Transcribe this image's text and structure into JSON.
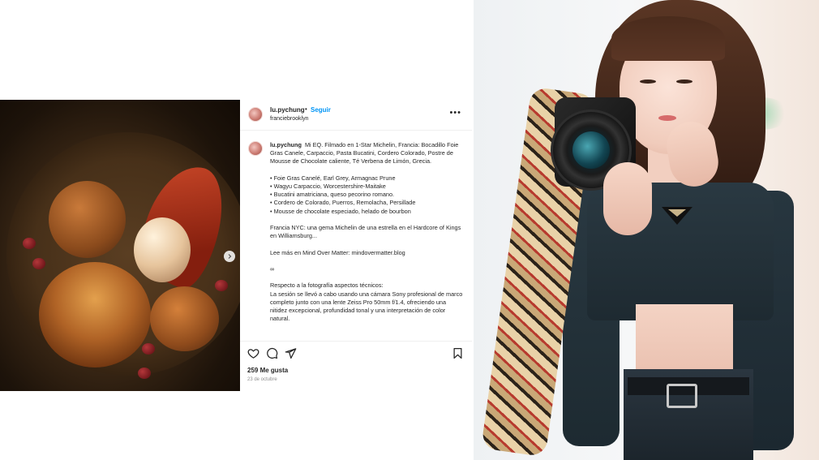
{
  "post": {
    "username": "lu.pychung",
    "separator": "•",
    "follow_label": "Seguir",
    "subtitle": "franciebrooklyn",
    "more_label": "•••",
    "caption": {
      "username": "lu.pychung",
      "intro": "Mi EQ. Filmado en 1-Star Michelin, Francia: Bocadillo Foie Gras Canele, Carpaccio, Pasta Bucatini, Cordero Colorado, Postre de Mousse de Chocolate caliente, Té Verbena de Limón, Grecia.",
      "items": [
        "• Foie Gras Canelé, Earl Grey, Armagnac Prune",
        "• Wagyu Carpaccio, Worcestershire-Maitake",
        "• Bucatini amatriciana, queso pecorino romano.",
        "• Cordero de Colorado, Puerros, Remolacha, Persillade",
        "• Mousse de chocolate especiado, helado de bourbon"
      ],
      "paragraph2": "Francia NYC: una gema Michelin de una estrella en el Hardcore of Kings en Williamsburg...",
      "paragraph3": "Lee más en Mind Over Matter: mindovermatter.blog",
      "paragraph4": "∞",
      "paragraph5_title": "Respecto a la fotografía aspectos técnicos:",
      "paragraph5_body": "La sesión se llevó a cabo usando una cámara Sony profesional de marco completo junto con una lente Zeiss Pro 50mm f/1.4, ofreciendo una nitidez excepcional, profundidad tonal y una interpretación de color natural."
    },
    "likes": "259 Me gusta",
    "date": "23 de octubre"
  },
  "icons": {
    "like": "heart-icon",
    "comment": "comment-icon",
    "share": "send-icon",
    "save": "bookmark-icon",
    "next": "chevron-right-icon",
    "more": "more-icon"
  },
  "colors": {
    "follow": "#0095f6",
    "text": "#262626",
    "muted": "#8e8e8e",
    "divider": "#efefef"
  }
}
